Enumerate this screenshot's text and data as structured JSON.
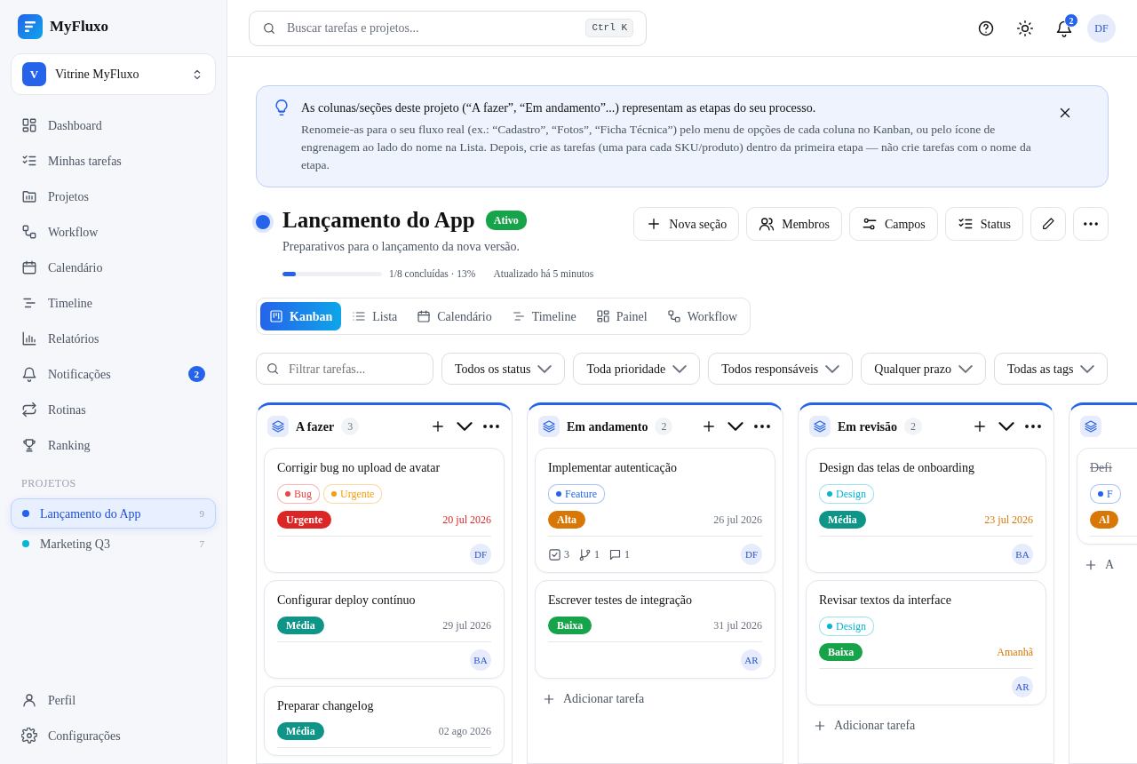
{
  "brand": {
    "name": "MyFluxo"
  },
  "workspace": {
    "initial": "V",
    "name": "Vitrine MyFluxo"
  },
  "nav": [
    {
      "label": "Dashboard"
    },
    {
      "label": "Minhas tarefas"
    },
    {
      "label": "Projetos"
    },
    {
      "label": "Workflow"
    },
    {
      "label": "Calendário"
    },
    {
      "label": "Timeline"
    },
    {
      "label": "Relatórios"
    },
    {
      "label": "Notificações",
      "badge": "2"
    },
    {
      "label": "Rotinas"
    },
    {
      "label": "Ranking"
    }
  ],
  "projects_heading": "PROJETOS",
  "projects": [
    {
      "name": "Lançamento do App",
      "count": "9",
      "color": "#2563eb",
      "selected": true
    },
    {
      "name": "Marketing Q3",
      "count": "7",
      "color": "#06b6d4",
      "selected": false
    }
  ],
  "footer_nav": [
    {
      "label": "Perfil"
    },
    {
      "label": "Configurações"
    }
  ],
  "topbar": {
    "search_placeholder": "Buscar tarefas e projetos...",
    "shortcut": "Ctrl K",
    "notifications": "2",
    "avatar": "DF"
  },
  "banner": {
    "title": "As colunas/seções deste projeto (“A fazer”, “Em andamento”...) representam as etapas do seu processo.",
    "body": "Renomeie-as para o seu fluxo real (ex.: “Cadastro”, “Fotos”, “Ficha Técnica”) pelo menu de opções de cada coluna no Kanban, ou pelo ícone de engrenagem ao lado do nome na Lista. Depois, crie as tarefas (uma para cada SKU/produto) dentro da primeira etapa — não crie tarefas com o nome da etapa."
  },
  "project": {
    "title": "Lançamento do App",
    "color": "#2563eb",
    "status": "Ativo",
    "description": "Preparativos para o lançamento da nova versão.",
    "level": 0.13,
    "progress": "1/8 concluídas · 13%",
    "updated": "Atualizado há 5 minutos"
  },
  "actions": [
    {
      "label": "Nova seção"
    },
    {
      "label": "Membros"
    },
    {
      "label": "Campos"
    },
    {
      "label": "Status"
    }
  ],
  "views": [
    {
      "label": "Kanban",
      "selected": true
    },
    {
      "label": "Lista",
      "selected": false
    },
    {
      "label": "Calendário",
      "selected": false
    },
    {
      "label": "Timeline",
      "selected": false
    },
    {
      "label": "Painel",
      "selected": false
    },
    {
      "label": "Workflow",
      "selected": false
    }
  ],
  "filters": {
    "placeholder": "Filtrar tarefas...",
    "selects": [
      "Todos os status",
      "Toda prioridade",
      "Todos responsáveis",
      "Qualquer prazo",
      "Todas as tags"
    ]
  },
  "columns": [
    {
      "title": "A fazer",
      "count": "3",
      "cards": [
        {
          "title": "Corrigir bug no upload de avatar",
          "done": false,
          "tags": [
            {
              "label": "Bug",
              "color": "#ef4444"
            },
            {
              "label": "Urgente",
              "color": "#f59e0b"
            }
          ],
          "priority": {
            "label": "Urgente",
            "color": "#dc2626"
          },
          "due": {
            "label": "20 jul 2026",
            "color": "#dc2626"
          },
          "assignee": "DF"
        },
        {
          "title": "Configurar deploy contínuo",
          "done": false,
          "priority": {
            "label": "Média",
            "color": "#0f9488"
          },
          "due": {
            "label": "29 jul 2026",
            "color": "#6b7280"
          },
          "assignee": "BA"
        },
        {
          "title": "Preparar changelog",
          "done": false,
          "priority": {
            "label": "Média",
            "color": "#0f9488"
          },
          "due": {
            "label": "02 ago 2026",
            "color": "#6b7280"
          }
        }
      ]
    },
    {
      "title": "Em andamento",
      "count": "2",
      "add": "Adicionar tarefa",
      "cards": [
        {
          "title": "Implementar autenticação",
          "done": false,
          "tags": [
            {
              "label": "Feature",
              "color": "#2563eb"
            }
          ],
          "priority": {
            "label": "Alta",
            "color": "#d97706"
          },
          "due": {
            "label": "26 jul 2026",
            "color": "#6b7280"
          },
          "meta": {
            "checklist": "3",
            "subtasks": "1",
            "comments": "1"
          },
          "assignee": "DF"
        },
        {
          "title": "Escrever testes de integração",
          "done": false,
          "priority": {
            "label": "Baixa",
            "color": "#16a34a"
          },
          "due": {
            "label": "31 jul 2026",
            "color": "#6b7280"
          },
          "assignee": "AR"
        }
      ]
    },
    {
      "title": "Em revisão",
      "count": "2",
      "add": "Adicionar tarefa",
      "cards": [
        {
          "title": "Design das telas de onboarding",
          "done": false,
          "tags": [
            {
              "label": "Design",
              "color": "#06b6d4"
            }
          ],
          "priority": {
            "label": "Média",
            "color": "#0f9488"
          },
          "due": {
            "label": "23 jul 2026",
            "color": "#d97706"
          },
          "assignee": "BA"
        },
        {
          "title": "Revisar textos da interface",
          "done": false,
          "tags": [
            {
              "label": "Design",
              "color": "#06b6d4"
            }
          ],
          "priority": {
            "label": "Baixa",
            "color": "#16a34a"
          },
          "due": {
            "label": "Amanhã",
            "color": "#d97706"
          },
          "assignee": "AR"
        }
      ]
    },
    {
      "add": "A",
      "cards": [
        {
          "title": "Defi",
          "done": true,
          "tags": [
            {
              "label": "F",
              "color": "#2563eb"
            }
          ],
          "priority": {
            "label": "Al",
            "color": "#d97706"
          }
        }
      ]
    }
  ]
}
